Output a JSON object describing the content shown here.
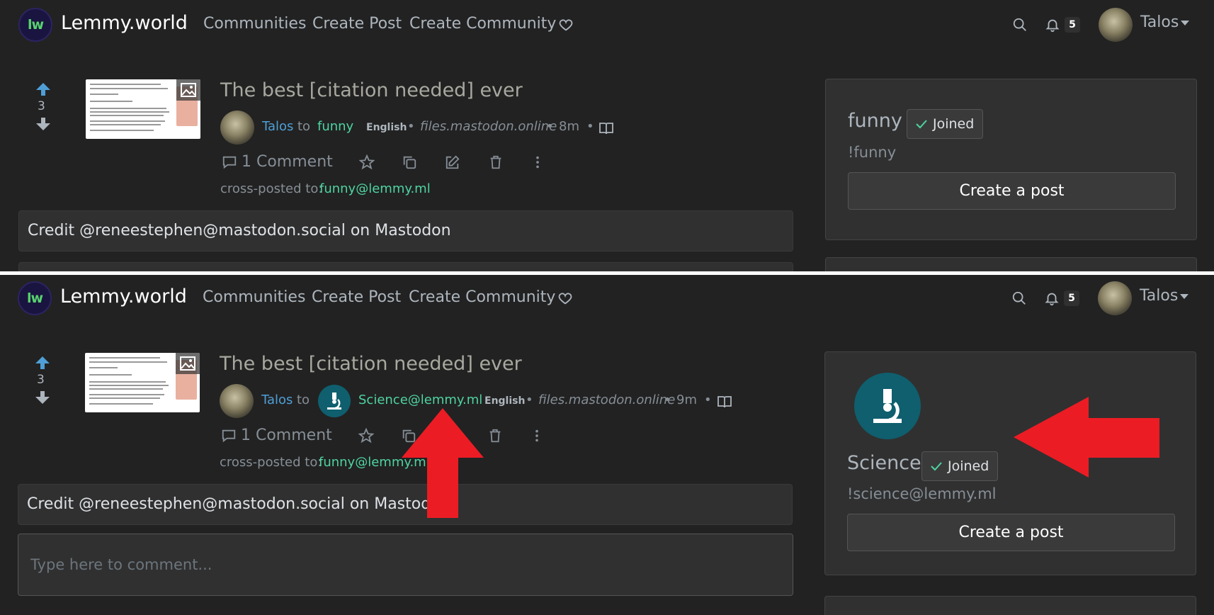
{
  "nav": {
    "logo_text": "lw",
    "brand": "Lemmy.world",
    "links": [
      "Communities",
      "Create Post",
      "Create Community"
    ],
    "notification_count": "5",
    "username": "Talos"
  },
  "post": {
    "score": "3",
    "title": "The best [citation needed] ever",
    "author": "Talos",
    "to": "to",
    "language": "English",
    "domain": "files.mastodon.online",
    "bullet": "•",
    "comments": "1 Comment",
    "cross_posted_label": "cross-posted to:",
    "cross_posted_target": "funny@lemmy.ml",
    "body": "Credit @reneestephen@mastodon.social on Mastodon"
  },
  "before": {
    "community": "funny",
    "time": "8m",
    "sidebar": {
      "name": "funny",
      "joined": "Joined",
      "handle": "!funny",
      "create_post": "Create a post"
    }
  },
  "after": {
    "community": "Science@lemmy.ml",
    "time": "9m",
    "comment_placeholder": "Type here to comment...",
    "sidebar": {
      "name": "Science",
      "joined": "Joined",
      "handle": "!science@lemmy.ml",
      "create_post": "Create a post"
    }
  },
  "colors": {
    "background": "#222222",
    "link_blue": "#4f9fd6",
    "community_green": "#4ed3a1",
    "science_icon": "#0f5f6e",
    "annotation_arrow": "#ec1c24"
  }
}
